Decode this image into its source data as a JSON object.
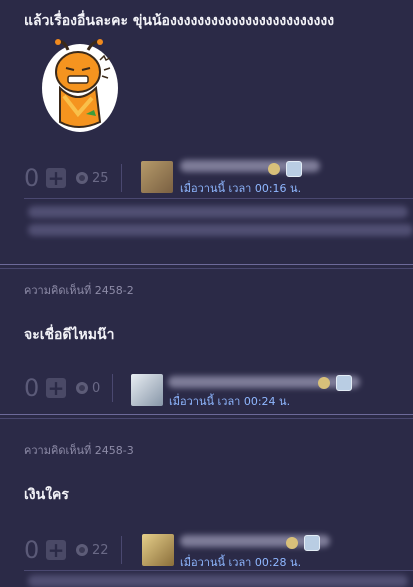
{
  "comment_top": {
    "text": "แล้วเรื่องอื่นละคะ ขุ่นน้องงงงงงงงงงงงงงงงงงงงงงงง",
    "sticker": "angry-orange-bug-sticker",
    "votes": "0",
    "emotion_count": "25",
    "time": "เมื่อวานนี้ เวลา 00:16 น."
  },
  "comment_2": {
    "label": "ความคิดเห็นที่ 2458-2",
    "text": "จะเชื่อดีไหมน๊า",
    "votes": "0",
    "emotion_count": "0",
    "time": "เมื่อวานนี้ เวลา 00:24 น."
  },
  "comment_3": {
    "label": "ความคิดเห็นที่ 2458-3",
    "text": "เงินใคร",
    "votes": "0",
    "emotion_count": "22",
    "time": "เมื่อวานนี้ เวลา 00:28 น."
  },
  "colors": {
    "background": "#2b2a47",
    "divider": "#6d6a9a",
    "time_link": "#8fb7ff"
  }
}
